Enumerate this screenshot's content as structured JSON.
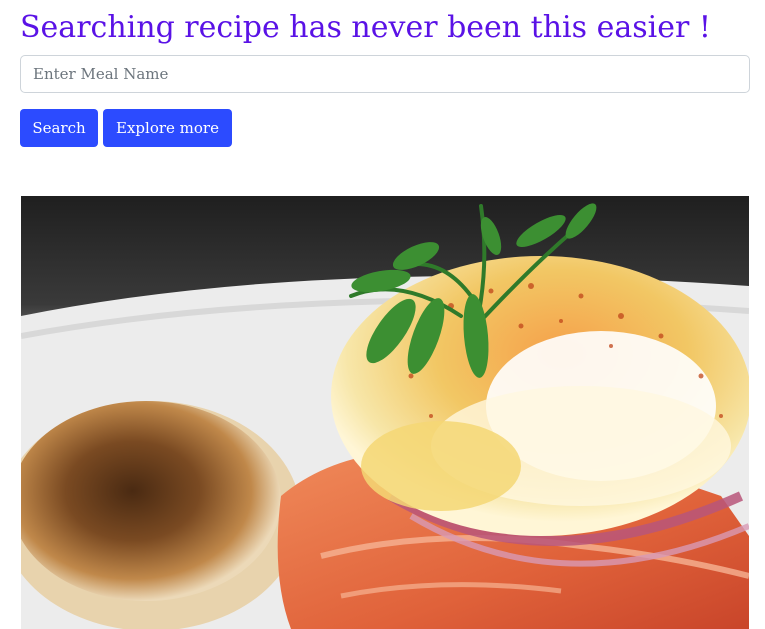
{
  "header": {
    "title": "Searching recipe has never been this easier !"
  },
  "search": {
    "placeholder": "Enter Meal Name",
    "value": ""
  },
  "actions": {
    "search_label": "Search",
    "explore_label": "Explore more"
  },
  "colors": {
    "title": "#5a12e6",
    "button": "#2c4bff"
  },
  "hero": {
    "icon": "food-photo"
  }
}
